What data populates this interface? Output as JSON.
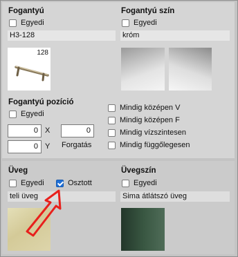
{
  "handle": {
    "title": "Fogantyú",
    "custom_label": "Egyedi",
    "custom_checked": false,
    "value": "H3-128",
    "thumb_label": "128"
  },
  "handle_color": {
    "title": "Fogantyú szín",
    "custom_label": "Egyedi",
    "custom_checked": false,
    "value": "króm"
  },
  "handle_position": {
    "title": "Fogantyú pozíció",
    "custom_label": "Egyedi",
    "custom_checked": false,
    "x_value": "0",
    "x_label": "X",
    "y_value": "0",
    "y_label": "Y",
    "rotation_value": "0",
    "rotation_label": "Forgatás",
    "options": [
      {
        "label": "Mindig középen V",
        "checked": false
      },
      {
        "label": "Mindig középen F",
        "checked": false
      },
      {
        "label": "Mindig vízszintesen",
        "checked": false
      },
      {
        "label": "Mindig függőlegesen",
        "checked": false
      }
    ]
  },
  "glass": {
    "title": "Üveg",
    "custom_label": "Egyedi",
    "custom_checked": false,
    "split_label": "Osztott",
    "split_checked": true,
    "value": "teli üveg"
  },
  "glass_color": {
    "title": "Üvegszín",
    "custom_label": "Egyedi",
    "custom_checked": false,
    "value": "Sima átlátszó üveg"
  },
  "colors": {
    "panel_bg": "#d5d5d5",
    "field_bg": "#e6e6e6",
    "check_accent": "#1f6fd6",
    "arrow": "#e8201c",
    "glass_swatch": "#d9d2a6",
    "glass_color_swatch": "#344f3a"
  }
}
